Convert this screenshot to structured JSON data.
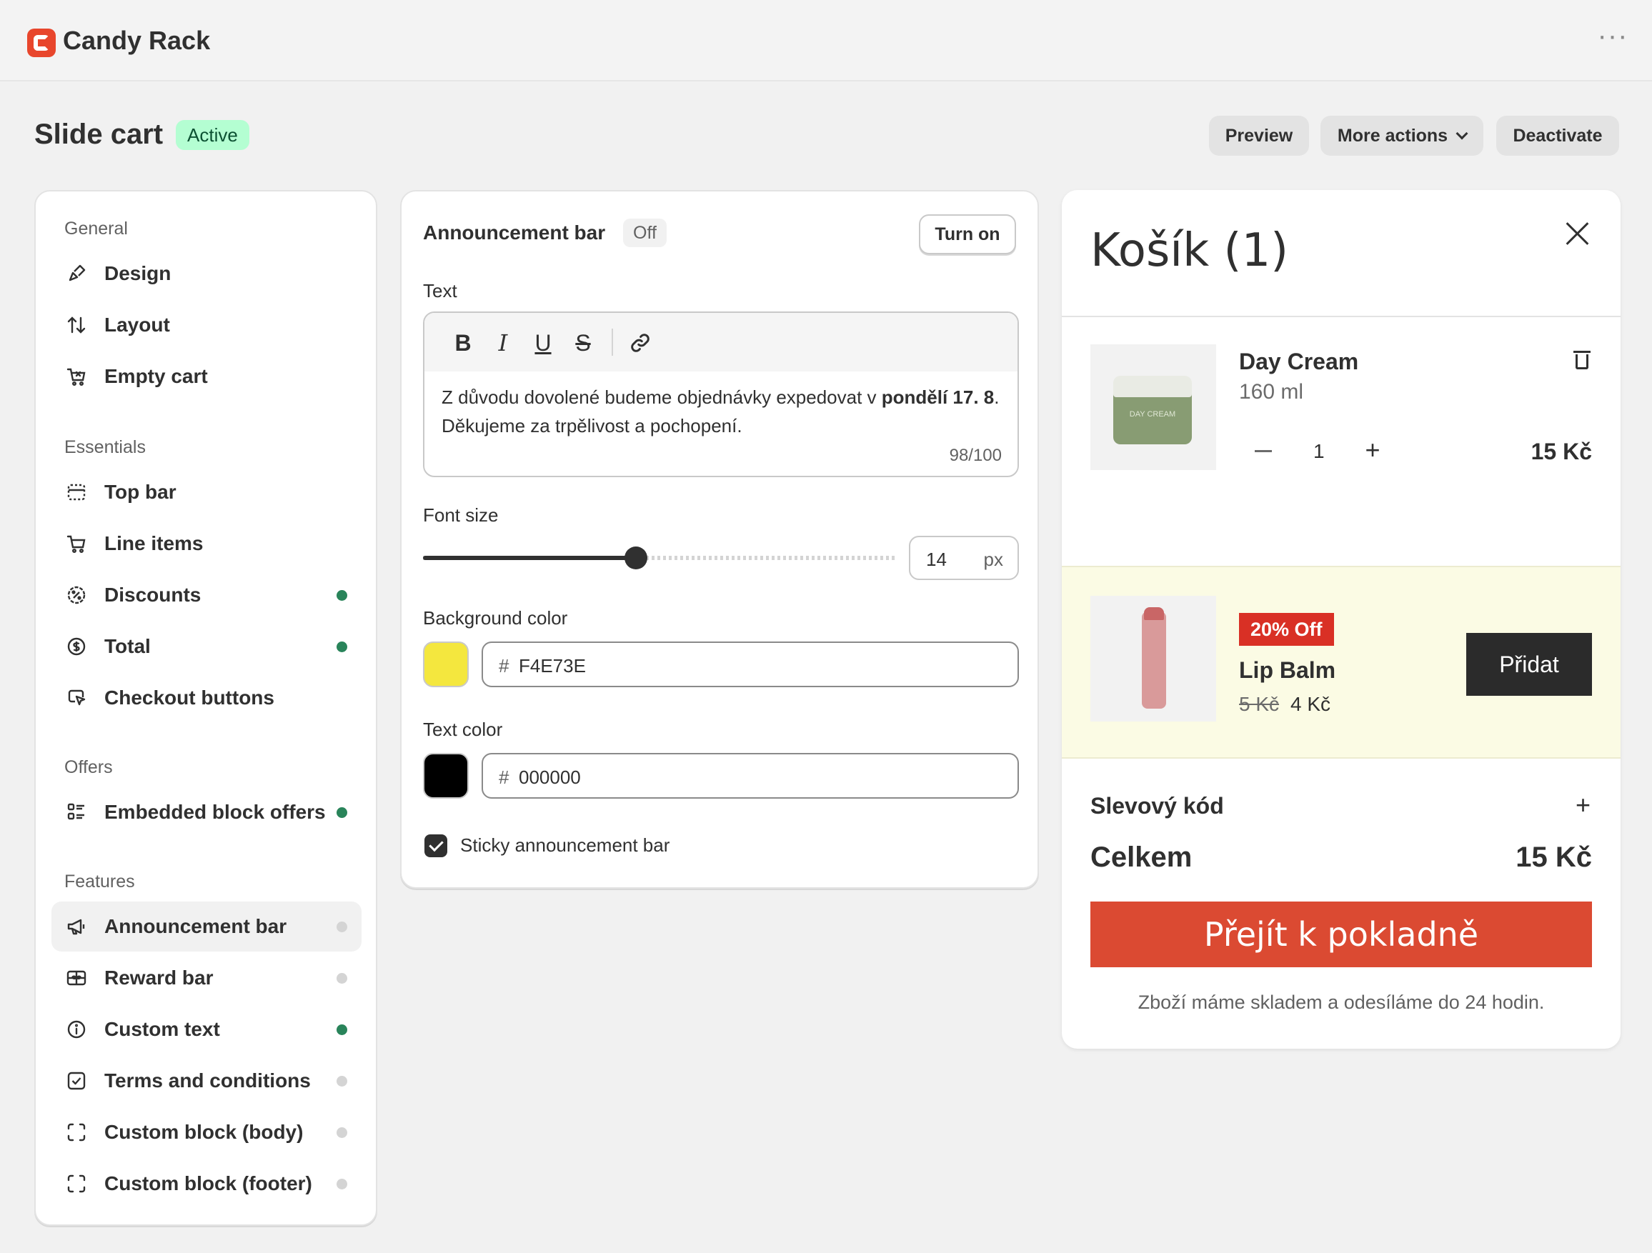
{
  "app": {
    "title": "Candy Rack"
  },
  "header": {
    "title": "Slide cart",
    "status": "Active",
    "preview": "Preview",
    "more_actions": "More actions",
    "deactivate": "Deactivate"
  },
  "sidebar": {
    "sections": {
      "general": "General",
      "essentials": "Essentials",
      "offers": "Offers",
      "features": "Features"
    },
    "items": {
      "design": {
        "label": "Design",
        "icon": "paintbrush-icon"
      },
      "layout": {
        "label": "Layout",
        "icon": "arrows-updown-icon"
      },
      "empty_cart": {
        "label": "Empty cart",
        "icon": "cart-x-icon"
      },
      "top_bar": {
        "label": "Top bar",
        "icon": "topbar-icon",
        "enabled": false
      },
      "line_items": {
        "label": "Line items",
        "icon": "cart-icon",
        "enabled": false
      },
      "discounts": {
        "label": "Discounts",
        "icon": "discount-icon",
        "enabled": true
      },
      "total": {
        "label": "Total",
        "icon": "dollar-icon",
        "enabled": true
      },
      "checkout_buttons": {
        "label": "Checkout buttons",
        "icon": "cursor-click-icon"
      },
      "embedded_block_offers": {
        "label": "Embedded block offers",
        "icon": "list-icon",
        "enabled": true
      },
      "announcement_bar": {
        "label": "Announcement bar",
        "icon": "megaphone-icon",
        "enabled": false,
        "selected": true
      },
      "reward_bar": {
        "label": "Reward bar",
        "icon": "gift-card-icon",
        "enabled": false
      },
      "custom_text": {
        "label": "Custom text",
        "icon": "info-icon",
        "enabled": true
      },
      "terms": {
        "label": "Terms and conditions",
        "icon": "checkbox-icon",
        "enabled": false
      },
      "custom_block_body": {
        "label": "Custom block (body)",
        "icon": "dashed-box-icon",
        "enabled": false
      },
      "custom_block_footer": {
        "label": "Custom block (footer)",
        "icon": "dashed-box-icon",
        "enabled": false
      }
    }
  },
  "settings": {
    "title": "Announcement bar",
    "status": "Off",
    "turn_on": "Turn on",
    "text_label": "Text",
    "text_plain_1": "Z důvodu dovolené budeme objednávky expedovat v ",
    "text_bold": "pondělí 17. 8",
    "text_plain_2": ". Děkujeme za trpělivost a pochopení.",
    "char_count": "98/100",
    "font_size_label": "Font size",
    "font_size": "14",
    "font_size_unit": "px",
    "font_size_fraction": 0.45,
    "bg_color_label": "Background color",
    "bg_color": "F4E73E",
    "bg_color_hex": "#F4E73E",
    "text_color_label": "Text color",
    "text_color": "000000",
    "text_color_hex": "#000000",
    "sticky_label": "Sticky announcement bar",
    "sticky_checked": true
  },
  "cart": {
    "title": "Košík (1)",
    "item": {
      "name": "Day Cream",
      "variant": "160 ml",
      "qty": "1",
      "price": "15 Kč",
      "image_label": "DAY CREAM"
    },
    "upsell": {
      "badge": "20% Off",
      "name": "Lip Balm",
      "old_price": "5 Kč",
      "new_price": "4 Kč",
      "add": "Přidat"
    },
    "discount_label": "Slevový kód",
    "total_label": "Celkem",
    "total": "15 Kč",
    "checkout": "Přejít k pokladně",
    "note": "Zboží máme skladem a odesíláme do 24 hodin."
  },
  "colors": {
    "accent_checkout": "#db4a32",
    "active_green": "#29845a",
    "badge_red": "#d93025"
  }
}
